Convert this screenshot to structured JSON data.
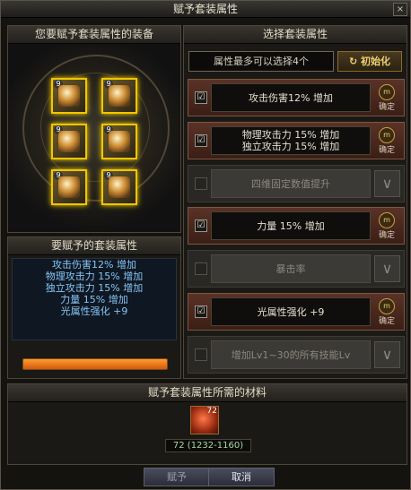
{
  "window": {
    "title": "赋予套装属性",
    "close_label": "×"
  },
  "equip_panel": {
    "title": "您要赋予套装属性的装备",
    "slots": [
      {
        "level": "9"
      },
      {
        "level": "9"
      },
      {
        "level": "9"
      },
      {
        "level": "9"
      },
      {
        "level": "9"
      },
      {
        "level": "9"
      }
    ]
  },
  "attr_panel": {
    "title": "要赋予的套装属性",
    "lines": [
      "攻击伤害12% 增加",
      "物理攻击力 15% 增加",
      "独立攻击力 15% 增加",
      "力量 15% 增加",
      "光属性强化 +9"
    ]
  },
  "select_panel": {
    "title": "选择套装属性",
    "max_text": "属性最多可以选择4个",
    "reset_label": "初始化",
    "confirm_label": "确定",
    "rows": [
      {
        "checked": true,
        "lines": [
          "攻击伤害12% 增加"
        ]
      },
      {
        "checked": true,
        "lines": [
          "物理攻击力 15% 增加",
          "独立攻击力 15% 增加"
        ]
      },
      {
        "checked": false,
        "lines": [
          "四维固定数值提升"
        ]
      },
      {
        "checked": true,
        "lines": [
          "力量 15% 增加"
        ]
      },
      {
        "checked": false,
        "lines": [
          "暴击率"
        ]
      },
      {
        "checked": true,
        "lines": [
          "光属性强化 +9"
        ]
      },
      {
        "checked": false,
        "lines": [
          "增加Lv1~30的所有技能Lv"
        ]
      }
    ]
  },
  "material_panel": {
    "title": "赋予套装属性所需的材料",
    "count": "72",
    "info": "72 (1232-1160)"
  },
  "buttons": {
    "apply": "赋予",
    "cancel": "取消"
  },
  "colors": {
    "accent_gold": "#f2c600",
    "attr_text": "#86c6f5",
    "active_row": "#5a3226"
  }
}
